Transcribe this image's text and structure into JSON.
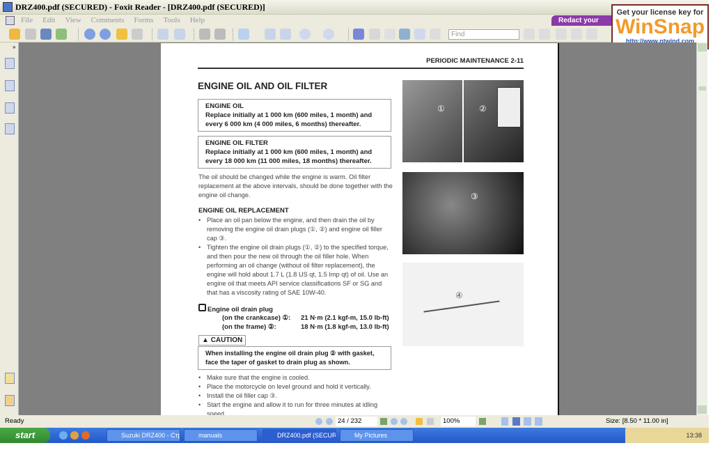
{
  "window": {
    "title": "DRZ400.pdf (SECURED) - Foxit Reader - [DRZ400.pdf (SECURED)]"
  },
  "menu": [
    "File",
    "Edit",
    "View",
    "Comments",
    "Forms",
    "Tools",
    "Help"
  ],
  "toolbar": {
    "find_placeholder": "Find",
    "redact_label": "Redact your PDFs"
  },
  "winsnap": {
    "line1": "Get your license key for",
    "logo": "WinSnap",
    "url": "http://www.ntwind.com"
  },
  "document": {
    "header": "PERIODIC MAINTENANCE   2-11",
    "title": "ENGINE OIL AND OIL FILTER",
    "box1": {
      "title": "ENGINE OIL",
      "text": "Replace initially at 1 000 km (600 miles, 1 month) and every 6 000 km (4 000 miles, 6 months) thereafter."
    },
    "box2": {
      "title": "ENGINE OIL FILTER",
      "text": "Replace initially at 1 000 km (600 miles, 1 month) and every 18 000 km (11 000 miles, 18 months) thereafter."
    },
    "intro": "The oil should be changed while the engine is warm. Oil filter replacement at the above intervals, should be done together with the engine oil change.",
    "section": "ENGINE OIL REPLACEMENT",
    "bullets1": [
      "Place an oil pan below the engine, and then drain the oil by removing the engine oil drain plugs (①, ②) and engine oil filler cap ③.",
      "Tighten the engine oil drain plugs (①, ②) to the specified torque, and then pour the new oil through the oil filler hole. When performing an oil change (without oil filter replacement), the engine will hold about 1.7 L (1.8 US qt, 1.5 Imp qt) of oil. Use an engine oil that meets API service classifications SF or SG and that has a viscosity rating of SAE 10W-40."
    ],
    "torque_title": "Engine oil drain plug",
    "torque": [
      {
        "label": "(on the crankcase) ①:",
        "value": "21 N·m (2.1 kgf-m, 15.0 lb-ft)"
      },
      {
        "label": "(on the frame) ②:",
        "value": "18 N·m (1.8 kgf-m, 13.0 lb-ft)"
      }
    ],
    "caution_label": "CAUTION",
    "caution_text": "When installing the engine oil drain plug ② with gasket, face the taper of gasket to drain plug as shown.",
    "bullets2": [
      "Make sure that the engine is cooled.",
      "Place the motorcycle on level ground and hold it vertically.",
      "Install the oil filler cap ③.",
      "Start the engine and allow it to run for three minutes at idling speed."
    ],
    "callouts": [
      "①",
      "②",
      "③",
      "④"
    ]
  },
  "status": {
    "text": "Ready",
    "page": "24 / 232",
    "zoom": "100%",
    "size": "Size: [8.50 * 11.00 in]"
  },
  "taskbar": {
    "start": "start",
    "tasks": [
      "Suzuki DRZ400 - Стр...",
      "manuals",
      "DRZ400.pdf (SECUR...",
      "My Pictures"
    ],
    "clock": "13:38"
  }
}
